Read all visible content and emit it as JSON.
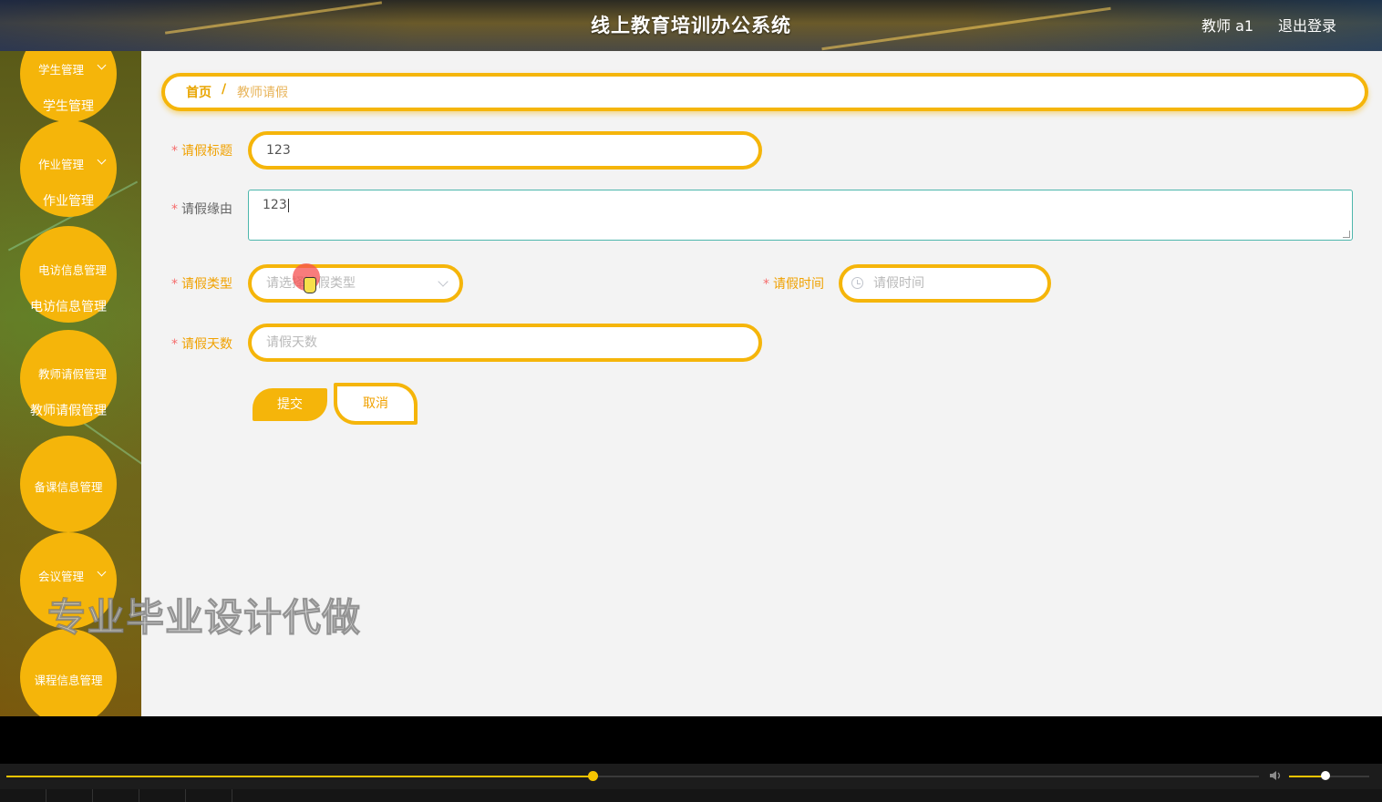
{
  "header": {
    "title": "线上教育培训办公系统",
    "user": "教师 a1",
    "logout": "退出登录"
  },
  "sidebar": {
    "menus": [
      {
        "label": "学生管理",
        "sub": "学生管理",
        "has_children": true
      },
      {
        "label": "作业管理",
        "sub": "作业管理",
        "has_children": true
      },
      {
        "label": "电访信息管理",
        "sub": "电访信息管理",
        "has_children": true
      },
      {
        "label": "教师请假管理",
        "sub": "教师请假管理",
        "has_children": true
      },
      {
        "label": "备课信息管理",
        "sub": "",
        "has_children": false
      },
      {
        "label": "会议管理",
        "sub": "",
        "has_children": true
      },
      {
        "label": "课程信息管理",
        "sub": "",
        "has_children": false
      }
    ]
  },
  "breadcrumb": {
    "home": "首页",
    "separator": "/",
    "current": "教师请假"
  },
  "form": {
    "title": {
      "label": "请假标题",
      "value": "123"
    },
    "reason": {
      "label": "请假缘由",
      "value": "123"
    },
    "type": {
      "label": "请假类型",
      "placeholder": "请选择请假类型"
    },
    "time": {
      "label": "请假时间",
      "placeholder": "请假时间"
    },
    "days": {
      "label": "请假天数",
      "placeholder": "请假天数"
    },
    "required_mark": "*",
    "submit": "提交",
    "cancel": "取消"
  },
  "watermark": "专业毕业设计代做",
  "player": {
    "progress": 0.468,
    "volume": 0.45
  },
  "colors": {
    "accent": "#f5b50a",
    "label": "#f0a100",
    "required": "#f56c6c"
  }
}
